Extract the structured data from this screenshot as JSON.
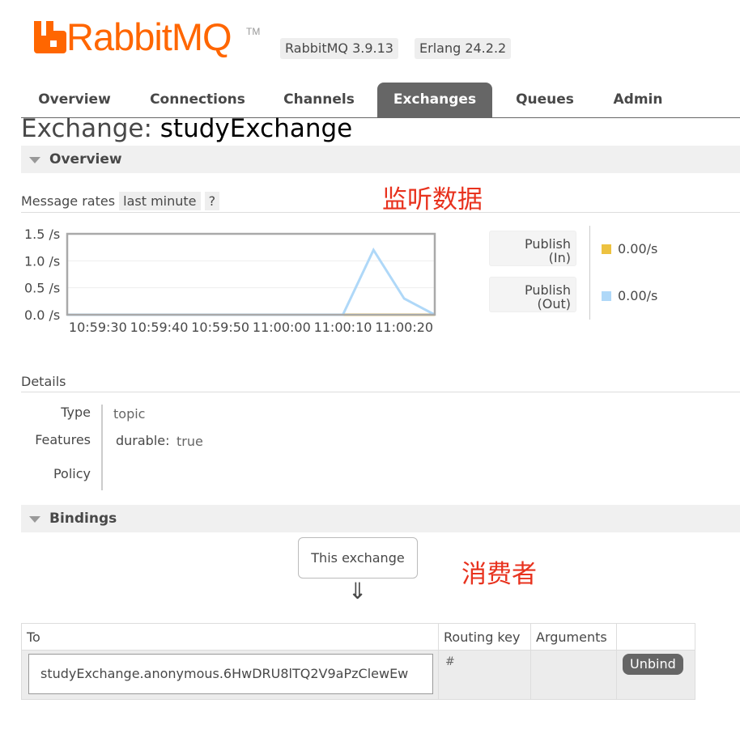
{
  "header": {
    "logo_text": "RabbitMQ",
    "logo_tm": "TM",
    "brand_color": "#ff6600",
    "version_label": "RabbitMQ 3.9.13",
    "erlang_label": "Erlang 24.2.2"
  },
  "nav": {
    "tabs": [
      {
        "label": "Overview",
        "active": false
      },
      {
        "label": "Connections",
        "active": false
      },
      {
        "label": "Channels",
        "active": false
      },
      {
        "label": "Exchanges",
        "active": true
      },
      {
        "label": "Queues",
        "active": false
      },
      {
        "label": "Admin",
        "active": false
      }
    ]
  },
  "page": {
    "title_prefix": "Exchange:",
    "exchange_name": "studyExchange"
  },
  "overview": {
    "section_label": "Overview",
    "message_rates_label": "Message rates",
    "range_label": "last minute",
    "help_label": "?",
    "annotation": "监听数据",
    "legend": [
      {
        "label_line1": "Publish",
        "label_line2": "(In)",
        "value": "0.00/s",
        "color": "#edc240"
      },
      {
        "label_line1": "Publish",
        "label_line2": "(Out)",
        "value": "0.00/s",
        "color": "#afd8f8"
      }
    ]
  },
  "chart_data": {
    "type": "line",
    "title": "",
    "xlabel": "",
    "ylabel": "",
    "ylim": [
      0,
      1.5
    ],
    "y_ticks": [
      "1.5 /s",
      "1.0 /s",
      "0.5 /s",
      "0.0 /s"
    ],
    "x_ticks": [
      "10:59:30",
      "10:59:40",
      "10:59:50",
      "11:00:00",
      "11:00:10",
      "11:00:20"
    ],
    "x": [
      "10:59:25",
      "10:59:30",
      "10:59:40",
      "10:59:50",
      "11:00:00",
      "11:00:10",
      "11:00:15",
      "11:00:20",
      "11:00:25"
    ],
    "series": [
      {
        "values": [
          0,
          0,
          0,
          0,
          0,
          0,
          0,
          0,
          0
        ],
        "color": "#edc240"
      },
      {
        "values": [
          0,
          0,
          0,
          0,
          0,
          0,
          1.2,
          0.3,
          0
        ],
        "color": "#afd8f8"
      }
    ]
  },
  "details": {
    "section_label": "Details",
    "type_label": "Type",
    "type_value": "topic",
    "features_label": "Features",
    "features_key": "durable:",
    "features_value": "true",
    "policy_label": "Policy"
  },
  "bindings": {
    "section_label": "Bindings",
    "this_exchange_label": "This exchange",
    "arrow": "⇓",
    "annotation": "消费者",
    "columns": [
      "To",
      "Routing key",
      "Arguments"
    ],
    "rows": [
      {
        "to": "studyExchange.anonymous.6HwDRU8lTQ2V9aPzClewEw",
        "routing_key": "#",
        "arguments": "",
        "action": "Unbind"
      }
    ]
  }
}
